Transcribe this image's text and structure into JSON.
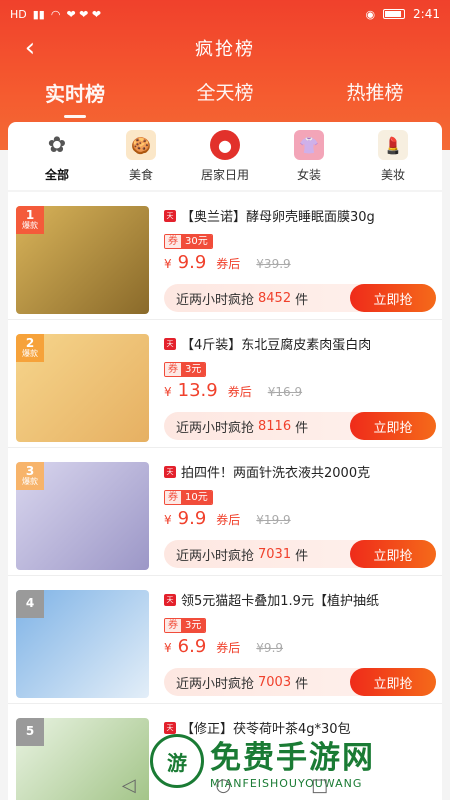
{
  "statusbar": {
    "left_text": "HD",
    "time": "2:41"
  },
  "nav": {
    "title": "疯抢榜"
  },
  "tabs": [
    {
      "label": "实时榜",
      "active": true
    },
    {
      "label": "全天榜",
      "active": false
    },
    {
      "label": "热推榜",
      "active": false
    }
  ],
  "categories": [
    {
      "label": "全部",
      "icon": "all-icon",
      "active": true
    },
    {
      "label": "美食",
      "icon": "food-icon",
      "active": false
    },
    {
      "label": "居家日用",
      "icon": "home-icon",
      "active": false
    },
    {
      "label": "女装",
      "icon": "clothing-icon",
      "active": false
    },
    {
      "label": "美妆",
      "icon": "cosmetics-icon",
      "active": false
    }
  ],
  "items": [
    {
      "rank": "1",
      "badge": "爆款",
      "title": "【奥兰诺】酵母卵壳睡眠面膜30g",
      "coupon_value": "30元",
      "currency": "¥",
      "price": "9.9",
      "after_label": "券后",
      "original_price": "¥39.9",
      "sale_prefix": "近两小时疯抢",
      "sold": "8452",
      "sale_unit": "件",
      "buy_label": "立即抢",
      "rank_color": "#f45b3a"
    },
    {
      "rank": "2",
      "badge": "爆款",
      "title": "【4斤装】东北豆腐皮素肉蛋白肉",
      "coupon_value": "3元",
      "currency": "¥",
      "price": "13.9",
      "after_label": "券后",
      "original_price": "¥16.9",
      "sale_prefix": "近两小时疯抢",
      "sold": "8116",
      "sale_unit": "件",
      "buy_label": "立即抢",
      "rank_color": "#f6a23a"
    },
    {
      "rank": "3",
      "badge": "爆款",
      "title": "拍四件！两面针洗衣液共2000克",
      "coupon_value": "10元",
      "currency": "¥",
      "price": "9.9",
      "after_label": "券后",
      "original_price": "¥19.9",
      "sale_prefix": "近两小时疯抢",
      "sold": "7031",
      "sale_unit": "件",
      "buy_label": "立即抢",
      "rank_color": "#f7b46b"
    },
    {
      "rank": "4",
      "badge": "",
      "title": "领5元猫超卡叠加1.9元【植护抽纸",
      "coupon_value": "3元",
      "currency": "¥",
      "price": "6.9",
      "after_label": "券后",
      "original_price": "¥9.9",
      "sale_prefix": "近两小时疯抢",
      "sold": "7003",
      "sale_unit": "件",
      "buy_label": "立即抢",
      "rank_color": "#9a9a9a"
    },
    {
      "rank": "5",
      "badge": "",
      "title": "【修正】茯苓荷叶茶4g*30包",
      "coupon_value": "",
      "currency": "",
      "price": "",
      "after_label": "",
      "original_price": "",
      "sale_prefix": "",
      "sold": "",
      "sale_unit": "",
      "buy_label": "",
      "rank_color": "#9a9a9a"
    }
  ],
  "watermark": {
    "main": "免费手游网",
    "sub": "MIANFEISHOUYOUWANG",
    "logo": "游"
  }
}
